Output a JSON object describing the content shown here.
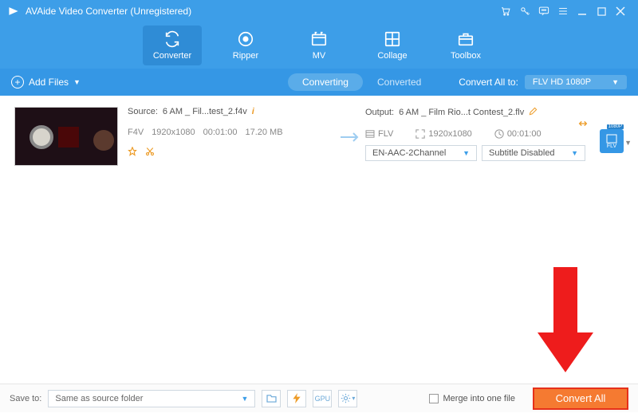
{
  "titlebar": {
    "title": "AVAide Video Converter (Unregistered)"
  },
  "toolbar": {
    "items": [
      {
        "label": "Converter"
      },
      {
        "label": "Ripper"
      },
      {
        "label": "MV"
      },
      {
        "label": "Collage"
      },
      {
        "label": "Toolbox"
      }
    ]
  },
  "subbar": {
    "add_label": "Add Files",
    "tabs": {
      "converting": "Converting",
      "converted": "Converted"
    },
    "convert_all_to": "Convert All to:",
    "format_selected": "FLV HD 1080P"
  },
  "item": {
    "source_label": "Source:",
    "source_name": "6 AM _ Fil...test_2.f4v",
    "codec": "F4V",
    "resolution": "1920x1080",
    "duration": "00:01:00",
    "size": "17.20 MB",
    "output_label": "Output:",
    "output_name": "6 AM _ Film Rio...t Contest_2.flv",
    "out_format": "FLV",
    "out_resolution": "1920x1080",
    "out_duration": "00:01:00",
    "audio_selected": "EN-AAC-2Channel",
    "subtitle_selected": "Subtitle Disabled",
    "badge_label": "FLV",
    "badge_top": "1080P"
  },
  "footer": {
    "save_to_label": "Save to:",
    "save_path": "Same as source folder",
    "merge_label": "Merge into one file",
    "convert_label": "Convert All"
  }
}
